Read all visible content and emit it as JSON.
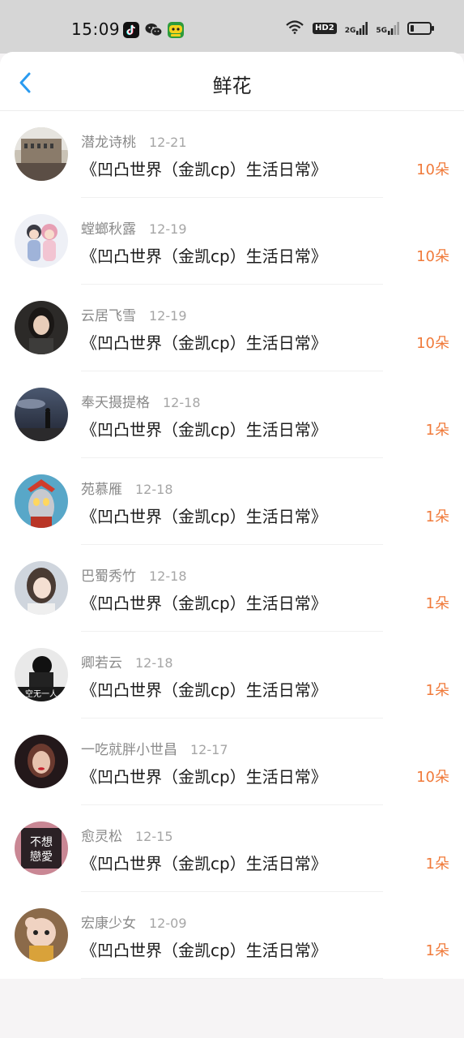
{
  "status_bar": {
    "time": "15:09",
    "app_icons": [
      "tiktok-icon",
      "wechat-icon",
      "game-app-icon"
    ],
    "hd_label": "HD2",
    "signal_2g_label": "2G",
    "signal_5g_label": "5G",
    "battery_level": 0.2
  },
  "header": {
    "title": "鲜花",
    "back_icon": "chevron-left-icon"
  },
  "colors": {
    "accent_back": "#2a9bf0",
    "count_orange": "#f07a3a"
  },
  "items": [
    {
      "name": "潜龙诗桃",
      "date": "12-21",
      "title": "《凹凸世界（金凯cp）生活日常》",
      "count": "10朵"
    },
    {
      "name": "螳螂秋露",
      "date": "12-19",
      "title": "《凹凸世界（金凯cp）生活日常》",
      "count": "10朵"
    },
    {
      "name": "云居飞雪",
      "date": "12-19",
      "title": "《凹凸世界（金凯cp）生活日常》",
      "count": "10朵"
    },
    {
      "name": "奉天摄提格",
      "date": "12-18",
      "title": "《凹凸世界（金凯cp）生活日常》",
      "count": "1朵"
    },
    {
      "name": "苑慕雁",
      "date": "12-18",
      "title": "《凹凸世界（金凯cp）生活日常》",
      "count": "1朵"
    },
    {
      "name": "巴蜀秀竹",
      "date": "12-18",
      "title": "《凹凸世界（金凯cp）生活日常》",
      "count": "1朵"
    },
    {
      "name": "卿若云",
      "date": "12-18",
      "title": "《凹凸世界（金凯cp）生活日常》",
      "count": "1朵"
    },
    {
      "name": "一吃就胖小世昌",
      "date": "12-17",
      "title": "《凹凸世界（金凯cp）生活日常》",
      "count": "10朵"
    },
    {
      "name": "愈灵松",
      "date": "12-15",
      "title": "《凹凸世界（金凯cp）生活日常》",
      "count": "1朵"
    },
    {
      "name": "宏康少女",
      "date": "12-09",
      "title": "《凹凸世界（金凯cp）生活日常》",
      "count": "1朵"
    }
  ]
}
